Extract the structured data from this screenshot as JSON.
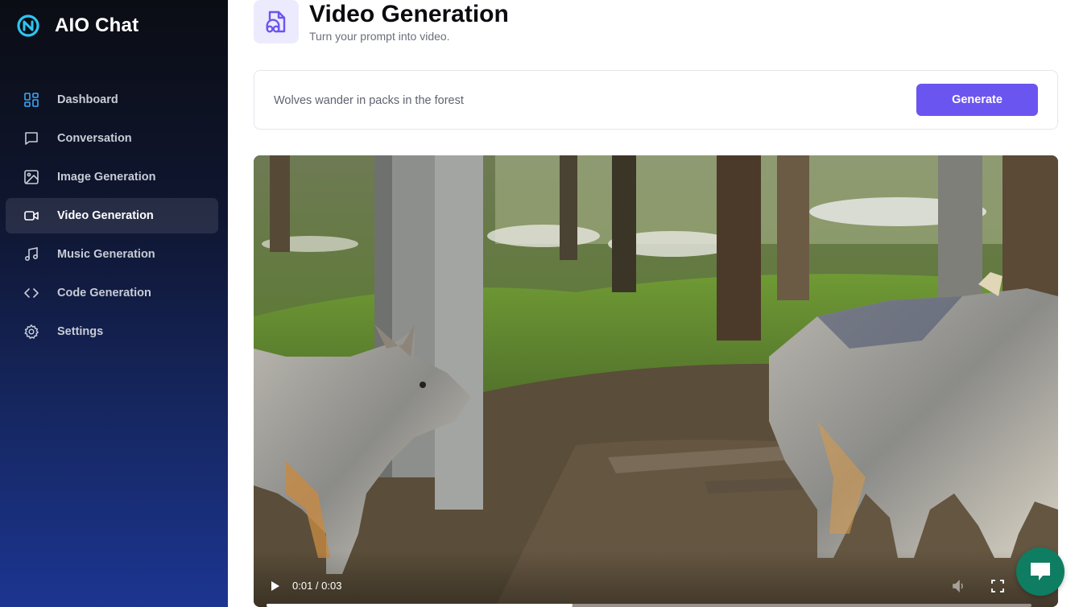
{
  "app": {
    "name": "AIO Chat"
  },
  "sidebar": {
    "items": [
      {
        "label": "Dashboard",
        "icon": "dashboard-icon",
        "active": false
      },
      {
        "label": "Conversation",
        "icon": "chat-bubble-icon",
        "active": false
      },
      {
        "label": "Image Generation",
        "icon": "image-icon",
        "active": false
      },
      {
        "label": "Video Generation",
        "icon": "video-icon",
        "active": true
      },
      {
        "label": "Music Generation",
        "icon": "music-icon",
        "active": false
      },
      {
        "label": "Code Generation",
        "icon": "code-icon",
        "active": false
      },
      {
        "label": "Settings",
        "icon": "gear-icon",
        "active": false
      }
    ]
  },
  "header": {
    "title": "Video Generation",
    "subtitle": "Turn your prompt into video.",
    "icon": "file-music-icon"
  },
  "prompt": {
    "value": "Wolves wander in packs in the forest",
    "button_label": "Generate"
  },
  "video": {
    "time_display": "0:01 / 0:03",
    "progress_fraction": 0.4
  },
  "colors": {
    "accent": "#6b55f0",
    "chat_fab": "#0f7d62",
    "sidebar_top": "#0b0d14",
    "sidebar_bottom": "#1c3591"
  }
}
